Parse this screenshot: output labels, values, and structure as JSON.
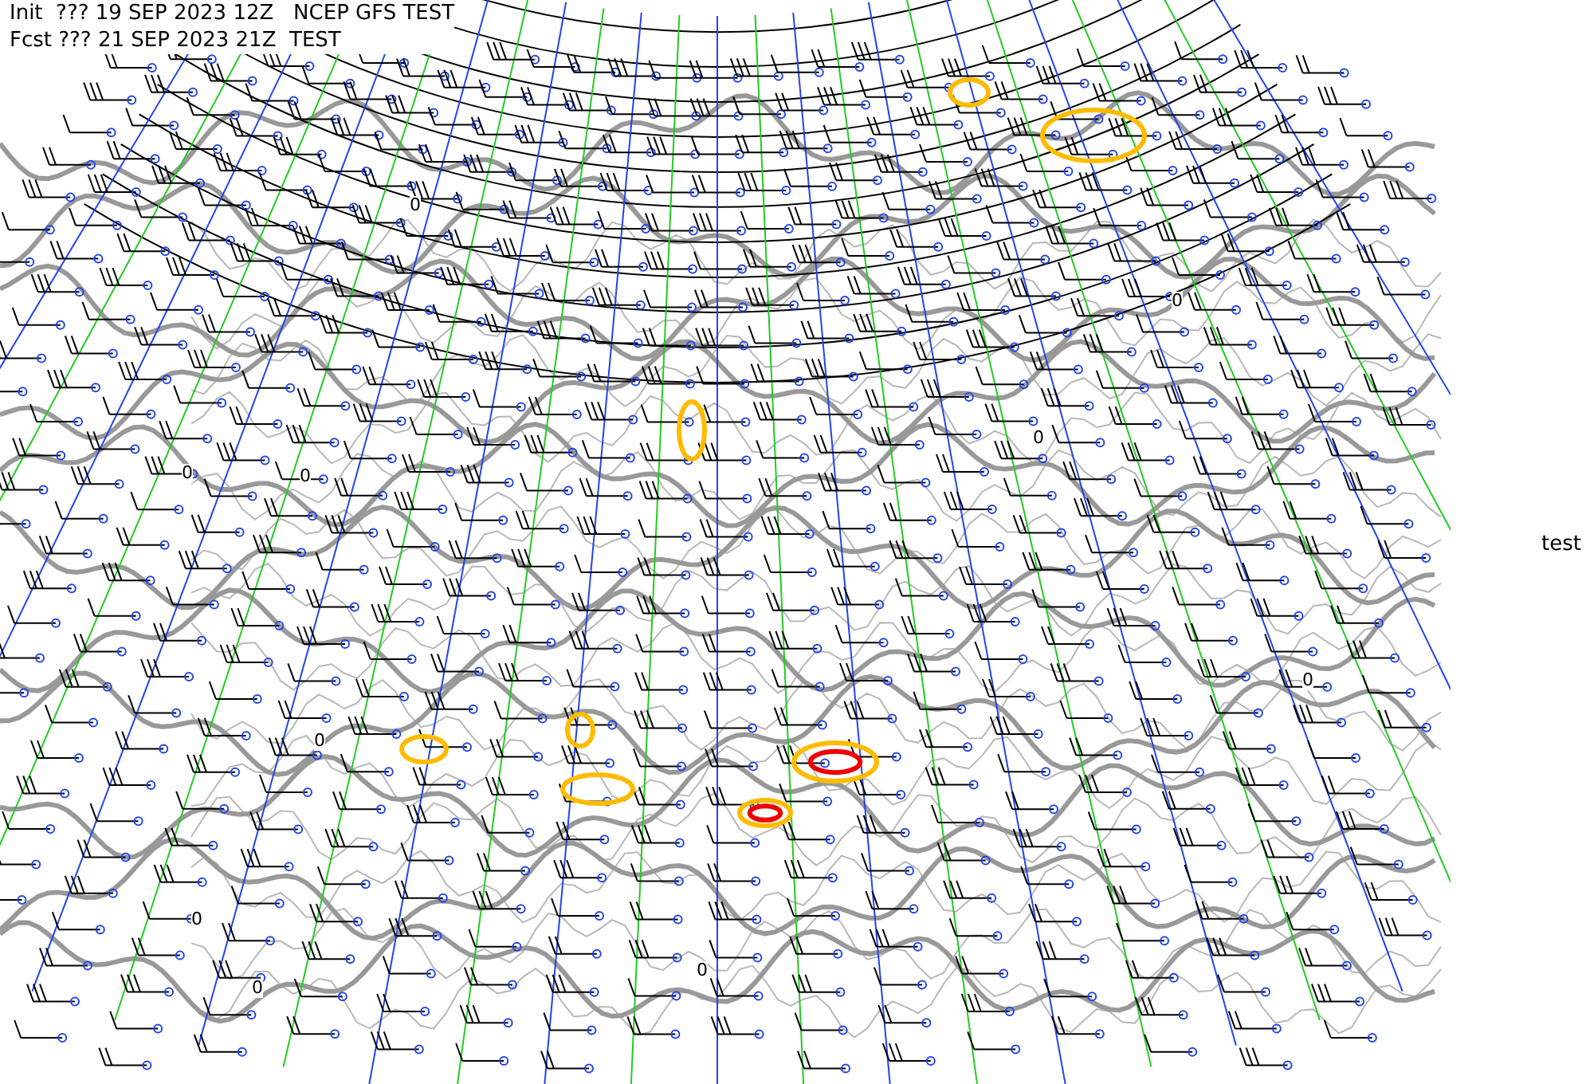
{
  "header": {
    "init_line": "Init  ??? 19 SEP 2023 12Z   NCEP GFS TEST",
    "forecast_line": "Fcst ??? 21 SEP 2023 21Z  TEST"
  },
  "contour_labels": [
    "0",
    "0",
    "0",
    "0",
    "0",
    "0",
    "0",
    "0",
    "0",
    "0"
  ],
  "side_label": "test"
}
